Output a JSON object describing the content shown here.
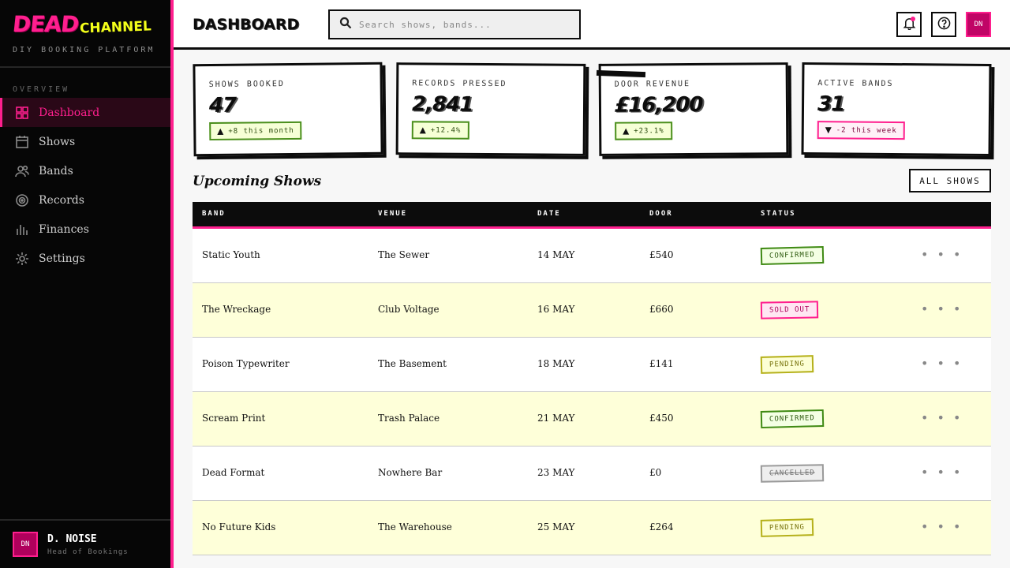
{
  "brand": {
    "logo_primary": "DEAD",
    "logo_secondary": "CHANNEL",
    "tagline": "DIY BOOKING PLATFORM"
  },
  "sidebar": {
    "section_label": "OVERVIEW",
    "items": [
      {
        "label": "Dashboard",
        "icon": "grid-icon",
        "active": true
      },
      {
        "label": "Shows",
        "icon": "calendar-icon"
      },
      {
        "label": "Bands",
        "icon": "users-icon"
      },
      {
        "label": "Records",
        "icon": "vinyl-icon"
      },
      {
        "label": "Finances",
        "icon": "bar-chart-icon"
      },
      {
        "label": "Settings",
        "icon": "gear-icon"
      }
    ],
    "user": {
      "initials": "DN",
      "name": "D. NOISE",
      "role": "Head of Bookings"
    }
  },
  "header": {
    "title": "DASHBOARD",
    "search_placeholder": "Search shows, bands...",
    "avatar_initials": "DN"
  },
  "stats": [
    {
      "label": "SHOWS BOOKED",
      "value": "47",
      "delta": "+8 this month",
      "trend": "up"
    },
    {
      "label": "RECORDS PRESSED",
      "value": "2,841",
      "delta": "+12.4%",
      "trend": "up"
    },
    {
      "label": "DOOR REVENUE",
      "value": "£16,200",
      "delta": "+23.1%",
      "trend": "up"
    },
    {
      "label": "ACTIVE BANDS",
      "value": "31",
      "delta": "-2 this week",
      "trend": "down"
    }
  ],
  "upcoming": {
    "title": "Upcoming Shows",
    "all_button": "ALL SHOWS",
    "columns": [
      "BAND",
      "VENUE",
      "DATE",
      "DOOR",
      "STATUS"
    ],
    "rows": [
      {
        "band": "Static Youth",
        "venue": "The Sewer",
        "date": "14 MAY",
        "door": "£540",
        "status": "CONFIRMED"
      },
      {
        "band": "The Wreckage",
        "venue": "Club Voltage",
        "date": "16 MAY",
        "door": "£660",
        "status": "SOLD OUT"
      },
      {
        "band": "Poison Typewriter",
        "venue": "The Basement",
        "date": "18 MAY",
        "door": "£141",
        "status": "PENDING"
      },
      {
        "band": "Scream Print",
        "venue": "Trash Palace",
        "date": "21 MAY",
        "door": "£450",
        "status": "CONFIRMED"
      },
      {
        "band": "Dead Format",
        "venue": "Nowhere Bar",
        "date": "23 MAY",
        "door": "£0",
        "status": "CANCELLED"
      },
      {
        "band": "No Future Kids",
        "venue": "The Warehouse",
        "date": "25 MAY",
        "door": "£264",
        "status": "PENDING"
      }
    ],
    "more_label": "• • •"
  },
  "colors": {
    "accent": "#ff1f8e",
    "highlight": "#f4ff1a",
    "ink": "#0c0c0c",
    "row_alt": "#feffd9"
  }
}
